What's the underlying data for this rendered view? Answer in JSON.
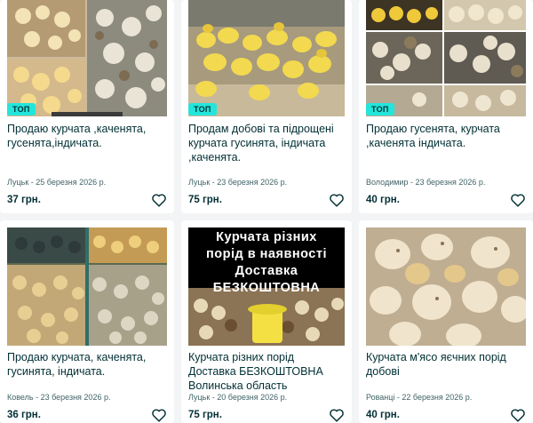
{
  "listings": [
    {
      "badge": "ТОП",
      "title": "Продаю курчата ,каченята, гусенята,індичата.",
      "meta": "Луцьк - 25 березня 2026 р.",
      "price": "37 грн."
    },
    {
      "badge": "ТОП",
      "title": "Продам добові та підрощені курчата гусинята, індичата ,каченята.",
      "meta": "Луцьк - 23 березня 2026 р.",
      "price": "75 грн."
    },
    {
      "badge": "ТОП",
      "title": "Продаю гусенята, курчата ,каченята індичата.",
      "meta": "Володимир - 23 березня 2026 р.",
      "price": "40 грн."
    },
    {
      "title": "Продаю курчата, каченята, гусинята, індичата.",
      "meta": "Ковель - 23 березня 2026 р.",
      "price": "36 грн."
    },
    {
      "title": "Курчата різних порід Доставка БЕЗКОШТОВНА Волинська область",
      "meta": "Луцьк - 20 березня 2026 р.",
      "price": "75 грн.",
      "photo_caption": [
        "Курчата різних",
        "порід в наявності",
        "Доставка",
        "БЕЗКОШТОВНА"
      ]
    },
    {
      "title": "Курчата м'ясо яєчних порід добові",
      "meta": "Рованці - 22 березня 2026 р.",
      "price": "40 грн."
    }
  ],
  "colors": {
    "badge": "#23e5db",
    "text": "#002f34",
    "meta": "#406367",
    "page_bg": "#f2f4f5"
  },
  "icons": {
    "favorite": "heart-outline-icon"
  }
}
